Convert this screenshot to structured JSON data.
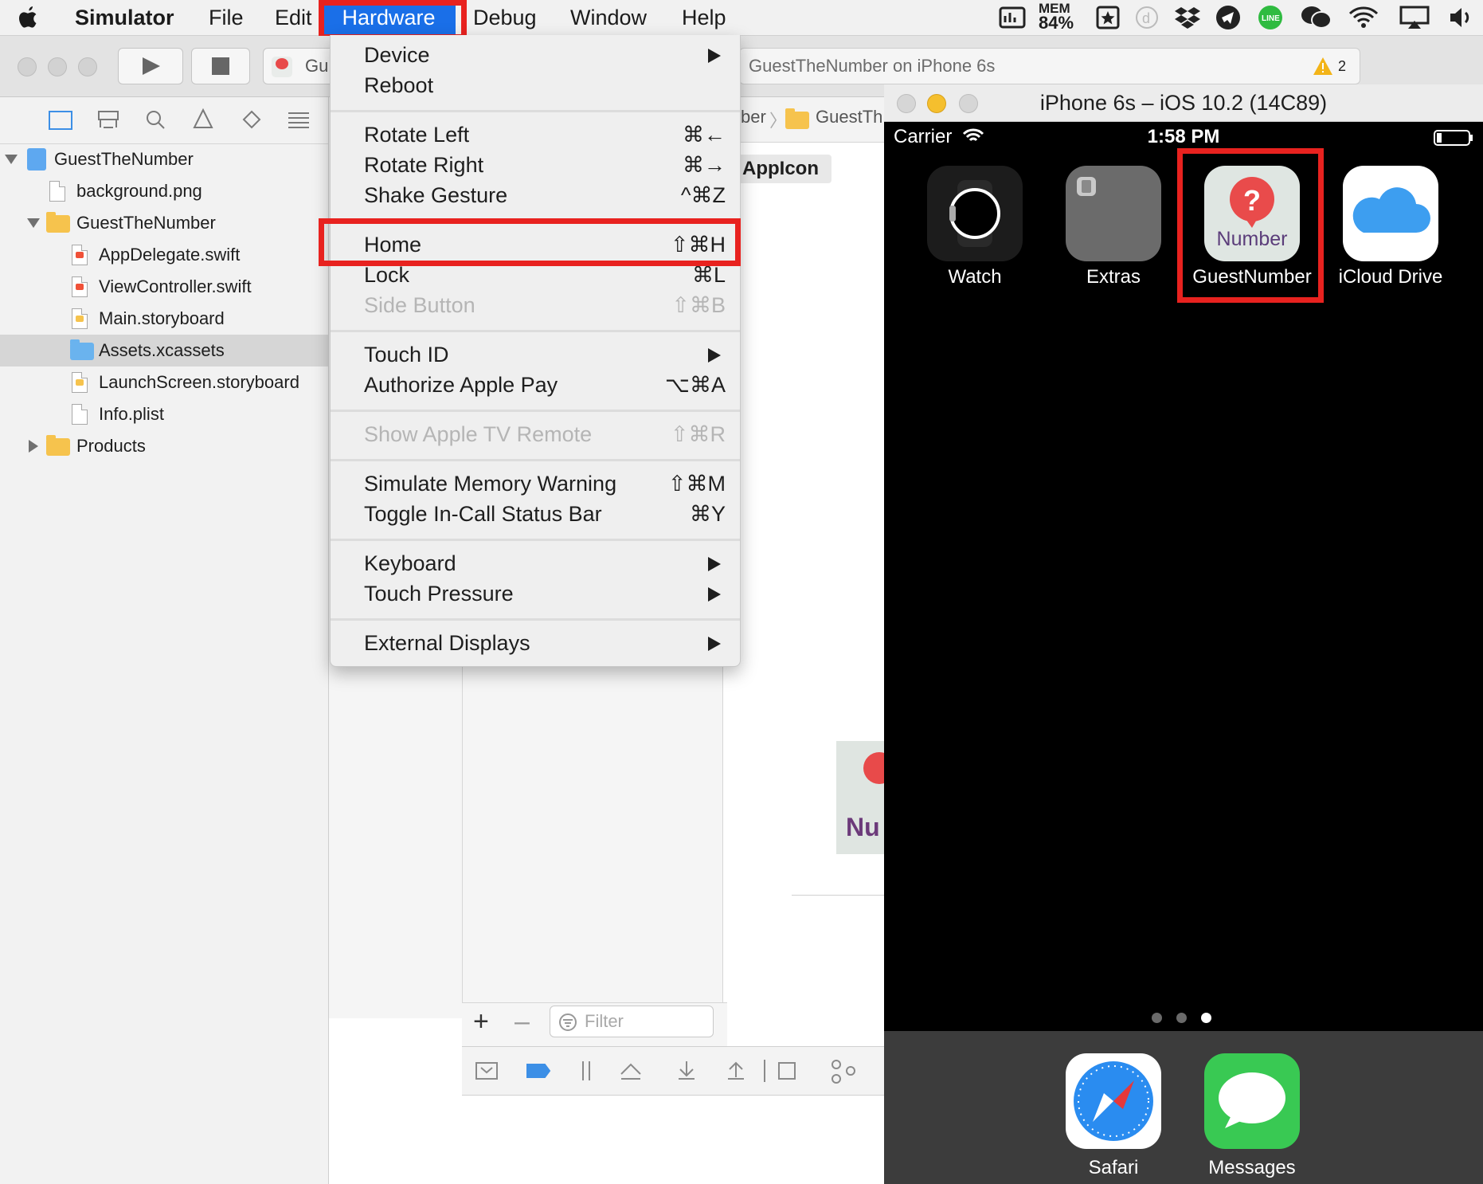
{
  "menubar": {
    "app_name": "Simulator",
    "items": [
      "File",
      "Edit",
      "Hardware",
      "Debug",
      "Window",
      "Help"
    ],
    "mem_label": "MEM",
    "mem_value": "84%"
  },
  "toolbar": {
    "scheme_label": "Gu",
    "activity_text": "GuestTheNumber on iPhone 6s",
    "warning_count": "2"
  },
  "navigator": {
    "items": [
      {
        "label": "GuestTheNumber"
      },
      {
        "label": "background.png"
      },
      {
        "label": "GuestTheNumber"
      },
      {
        "label": "AppDelegate.swift"
      },
      {
        "label": "ViewController.swift"
      },
      {
        "label": "Main.storyboard"
      },
      {
        "label": "Assets.xcassets"
      },
      {
        "label": "LaunchScreen.storyboard"
      },
      {
        "label": "Info.plist"
      },
      {
        "label": "Products"
      }
    ]
  },
  "editor": {
    "breadcrumb_tail": "ber",
    "breadcrumb_folder": "GuestTh",
    "appicon_tag": "AppIcon",
    "filter_placeholder": "Filter",
    "icon_preview_text": "Nu"
  },
  "hardware_menu": {
    "items": [
      {
        "label": "Device",
        "shortcut": ""
      },
      {
        "label": "Reboot",
        "shortcut": ""
      },
      {
        "label": "Rotate Left",
        "shortcut": "⌘←"
      },
      {
        "label": "Rotate Right",
        "shortcut": "⌘→"
      },
      {
        "label": "Shake Gesture",
        "shortcut": "^⌘Z"
      },
      {
        "label": "Home",
        "shortcut": "⇧⌘H"
      },
      {
        "label": "Lock",
        "shortcut": "⌘L"
      },
      {
        "label": "Side Button",
        "shortcut": "⇧⌘B"
      },
      {
        "label": "Touch ID",
        "shortcut": ""
      },
      {
        "label": "Authorize Apple Pay",
        "shortcut": "⌥⌘A"
      },
      {
        "label": "Show Apple TV Remote",
        "shortcut": "⇧⌘R"
      },
      {
        "label": "Simulate Memory Warning",
        "shortcut": "⇧⌘M"
      },
      {
        "label": "Toggle In-Call Status Bar",
        "shortcut": "⌘Y"
      },
      {
        "label": "Keyboard",
        "shortcut": ""
      },
      {
        "label": "Touch Pressure",
        "shortcut": ""
      },
      {
        "label": "External Displays",
        "shortcut": ""
      }
    ]
  },
  "simulator": {
    "title": "iPhone 6s – iOS 10.2 (14C89)",
    "carrier": "Carrier",
    "time": "1:58 PM",
    "apps": [
      "Watch",
      "Extras",
      "GuestNumber",
      "iCloud Drive"
    ],
    "guestnumber_icon_text": "Number",
    "dock_apps": [
      "Safari",
      "Messages"
    ],
    "page_count": 3,
    "current_page": 3
  },
  "colors": {
    "highlight_red": "#e8221f",
    "menu_selected_blue": "#1a6fe8"
  }
}
